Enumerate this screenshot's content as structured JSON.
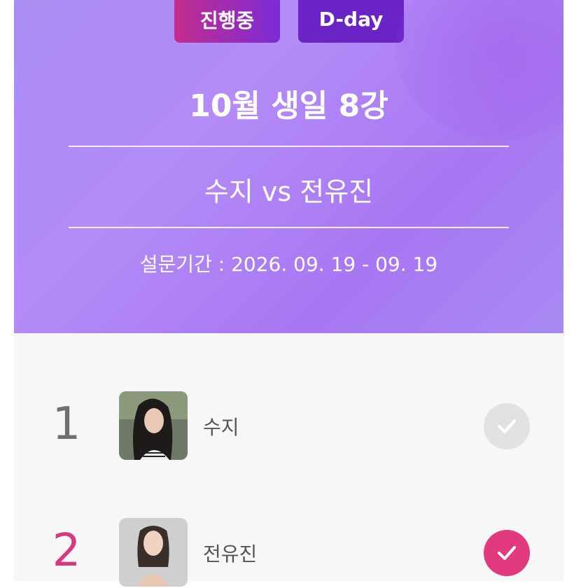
{
  "header": {
    "status_badge": "진행중",
    "dday_badge": "D-day",
    "title": "10월 생일 8강",
    "matchup": "수지 vs 전유진",
    "period": "설문기간 : 2026. 09. 19 - 09. 19"
  },
  "candidates": [
    {
      "rank": "1",
      "name": "수지",
      "selected": false,
      "rank_color": "#707070",
      "check_color": "#e2e2e2"
    },
    {
      "rank": "2",
      "name": "전유진",
      "selected": true,
      "rank_color": "#d63a7c",
      "check_color": "#e23a7e"
    }
  ],
  "icons": {
    "check": "check-icon",
    "photo": "avatar-photo"
  }
}
